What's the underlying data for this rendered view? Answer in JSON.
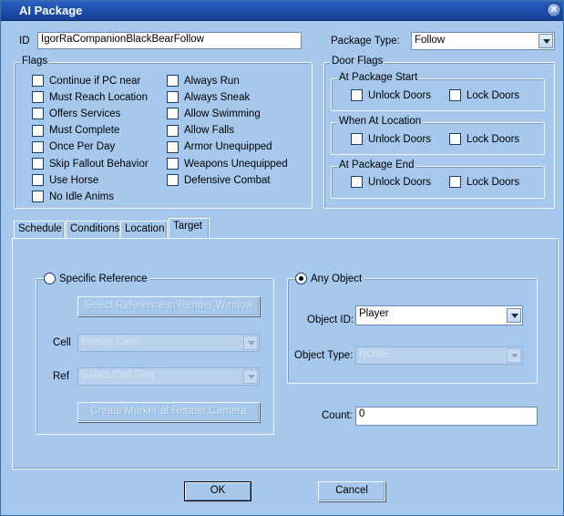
{
  "window": {
    "title": "AI Package"
  },
  "id_field": {
    "label": "ID",
    "value": "IgorRaCompanionBlackBearFollow"
  },
  "package_type": {
    "label": "Package Type:",
    "value": "Follow"
  },
  "flags": {
    "title": "Flags",
    "col1": [
      {
        "label": "Continue if PC near",
        "checked": false
      },
      {
        "label": "Must Reach Location",
        "checked": false
      },
      {
        "label": "Offers Services",
        "checked": false
      },
      {
        "label": "Must Complete",
        "checked": false
      },
      {
        "label": "Once Per Day",
        "checked": false
      },
      {
        "label": "Skip Fallout Behavior",
        "checked": false
      },
      {
        "label": "Use Horse",
        "checked": false
      },
      {
        "label": "No Idle Anims",
        "checked": false
      }
    ],
    "col2": [
      {
        "label": "Always Run",
        "checked": false
      },
      {
        "label": "Always Sneak",
        "checked": false
      },
      {
        "label": "Allow Swimming",
        "checked": false
      },
      {
        "label": "Allow Falls",
        "checked": false
      },
      {
        "label": "Armor Unequipped",
        "checked": false
      },
      {
        "label": "Weapons Unequipped",
        "checked": false
      },
      {
        "label": "Defensive Combat",
        "checked": false
      }
    ]
  },
  "door_flags": {
    "title": "Door Flags",
    "groups": [
      {
        "title": "At Package Start",
        "unlock": "Unlock Doors",
        "lock": "Lock Doors"
      },
      {
        "title": "When At Location",
        "unlock": "Unlock Doors",
        "lock": "Lock Doors"
      },
      {
        "title": "At Package End",
        "unlock": "Unlock Doors",
        "lock": "Lock Doors"
      }
    ]
  },
  "tabs": [
    {
      "label": "Schedule"
    },
    {
      "label": "Conditions"
    },
    {
      "label": "Location"
    },
    {
      "label": "Target",
      "active": true
    }
  ],
  "target": {
    "specific": {
      "label": "Specific Reference",
      "selected": false,
      "select_btn": "Select Reference in Render Window",
      "cell_label": "Cell",
      "cell_value": "Interior Cells",
      "ref_label": "Ref",
      "ref_value": "Select Cell First",
      "marker_btn": "Create Marker at Render Camera"
    },
    "any": {
      "label": "Any Object",
      "selected": true,
      "object_id_label": "Object ID:",
      "object_id_value": "Player",
      "object_type_label": "Object Type:",
      "object_type_value": "NONE"
    },
    "count_label": "Count:",
    "count_value": "0"
  },
  "buttons": {
    "ok": "OK",
    "cancel": "Cancel"
  }
}
